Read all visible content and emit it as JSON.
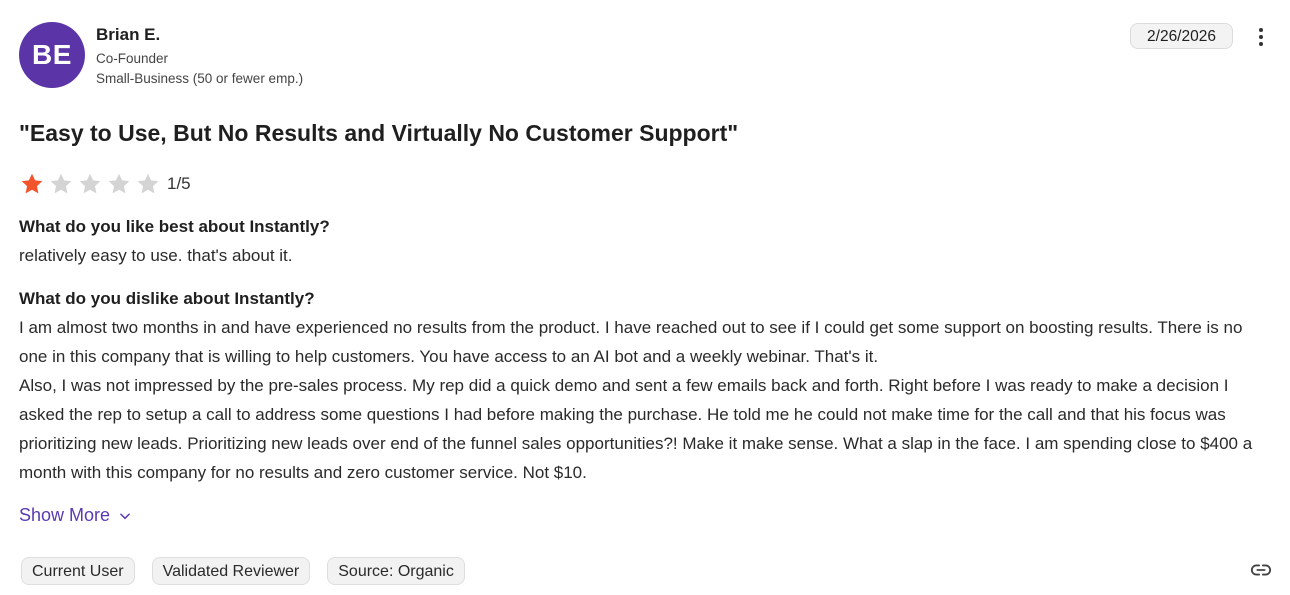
{
  "reviewer": {
    "initials": "BE",
    "name": "Brian E.",
    "title": "Co-Founder",
    "company_size": "Small-Business (50 or fewer emp.)",
    "avatar_color": "#5b35a8"
  },
  "date": "2/26/2026",
  "review": {
    "title": "\"Easy to Use, But No Results and Virtually No Customer Support\"",
    "rating": 1,
    "rating_max": 5,
    "rating_text": "1/5",
    "star_color_filled": "#f2542d",
    "star_color_empty": "#d4d4d4",
    "like_question": "What do you like best about Instantly?",
    "like_answer": "relatively easy to use. that's about it.",
    "dislike_question": "What do you dislike about Instantly?",
    "dislike_answer_p1": "I am almost two months in and have experienced no results from the product. I have reached out to see if I could get some support on boosting results. There is no one in this company that is willing to help customers. You have access to an AI bot and a weekly webinar. That's it.",
    "dislike_answer_p2": "Also, I was not impressed by the pre-sales process. My rep did a quick demo and sent a few emails back and forth. Right before I was ready to make a decision I asked the rep to setup a call to address some questions I had before making the purchase. He told me he could not make time for the call and that his focus was prioritizing new leads. Prioritizing new leads over end of the funnel sales opportunities?! Make it make sense. What a slap in the face. I am spending close to $400 a month with this company for no results and zero customer service. Not $10."
  },
  "show_more_label": "Show More",
  "accent_color": "#5a3ab0",
  "tags": [
    "Current User",
    "Validated Reviewer",
    "Source: Organic"
  ],
  "icons": {
    "menu": "more-vertical-icon",
    "chevron": "chevron-down-icon",
    "link": "link-icon",
    "star": "star-icon"
  }
}
